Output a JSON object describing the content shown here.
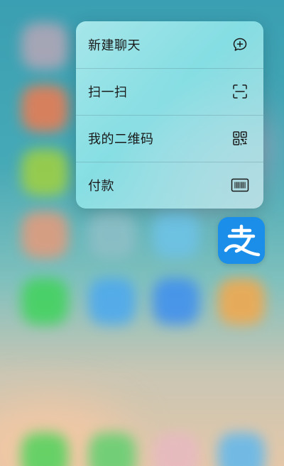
{
  "menu": {
    "items": [
      {
        "label": "新建聊天",
        "icon": "chat-bubble-plus-icon"
      },
      {
        "label": "扫一扫",
        "icon": "scan-icon"
      },
      {
        "label": "我的二维码",
        "icon": "qr-code-icon"
      },
      {
        "label": "付款",
        "icon": "barcode-icon"
      }
    ]
  },
  "app": {
    "icon": "alipay-icon",
    "glyph": "支",
    "color": "#1a8ee8"
  }
}
